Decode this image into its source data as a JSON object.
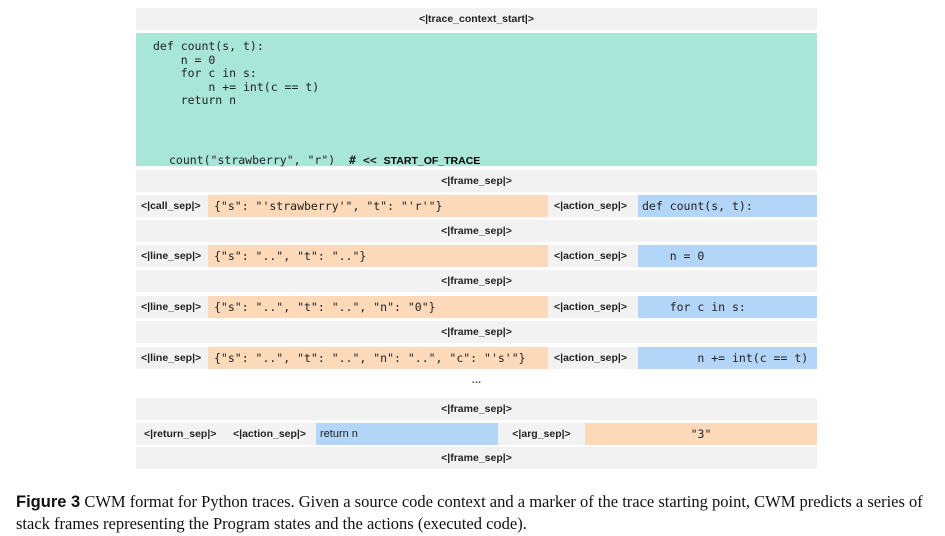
{
  "trace_context_start": "<|trace_context_start|>",
  "context": {
    "code_lines": [
      "def count(s, t):",
      "    n = 0",
      "    for c in s:",
      "        n += int(c == t)",
      "    return n"
    ],
    "call_code": "count(\"strawberry\", \"r\")",
    "marker_comment": "# << ",
    "marker": "START_OF_TRACE"
  },
  "frame_sep": "<|frame_sep|>",
  "frames": [
    {
      "sep": "<|call_sep|>",
      "state": "{\"s\": \"'strawberry'\", \"t\": \"'r'\"}",
      "action_sep": "<|action_sep|>",
      "action": "def count(s, t):"
    },
    {
      "sep": "<|line_sep|>",
      "state": "{\"s\": \"..\", \"t\": \"..\"}",
      "action_sep": "<|action_sep|>",
      "action": "    n = 0"
    },
    {
      "sep": "<|line_sep|>",
      "state": "{\"s\": \"..\", \"t\": \"..\", \"n\": \"0\"}",
      "action_sep": "<|action_sep|>",
      "action": "    for c in s:"
    },
    {
      "sep": "<|line_sep|>",
      "state": "{\"s\": \"..\", \"t\": \"..\", \"n\": \"..\", \"c\": \"'s'\"}",
      "action_sep": "<|action_sep|>",
      "action": "        n += int(c == t)"
    }
  ],
  "ellipsis": "...",
  "return_row": {
    "return_sep": "<|return_sep|>",
    "action_sep": "<|action_sep|>",
    "action": "return n",
    "arg_sep": "<|arg_sep|>",
    "value": "\"3\""
  },
  "caption": {
    "label": "Figure 3",
    "text": " CWM format for Python traces. Given a source code context and a marker of the trace starting point, CWM predicts a series of stack frames representing the Program states and the actions (executed code)."
  }
}
